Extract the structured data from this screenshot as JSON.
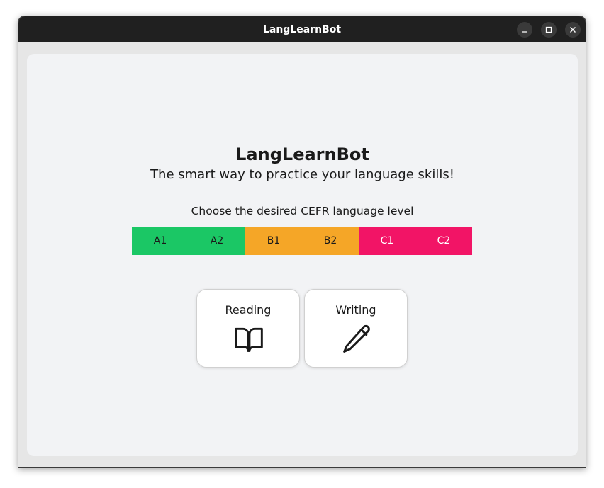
{
  "window": {
    "title": "LangLearnBot",
    "controls": [
      "minimize-icon",
      "maximize-icon",
      "close-icon"
    ]
  },
  "header": {
    "title": "LangLearnBot",
    "subtitle": "The smart way to practice your language skills!"
  },
  "level_selector": {
    "label": "Choose the desired CEFR language level",
    "levels": [
      {
        "label": "A1",
        "color": "#1bc765"
      },
      {
        "label": "A2",
        "color": "#1bc765"
      },
      {
        "label": "B1",
        "color": "#f5a627"
      },
      {
        "label": "B2",
        "color": "#f5a627"
      },
      {
        "label": "C1",
        "color": "#f21466"
      },
      {
        "label": "C2",
        "color": "#f21466"
      }
    ]
  },
  "modes": [
    {
      "label": "Reading",
      "icon": "book-icon"
    },
    {
      "label": "Writing",
      "icon": "pencil-icon"
    }
  ]
}
